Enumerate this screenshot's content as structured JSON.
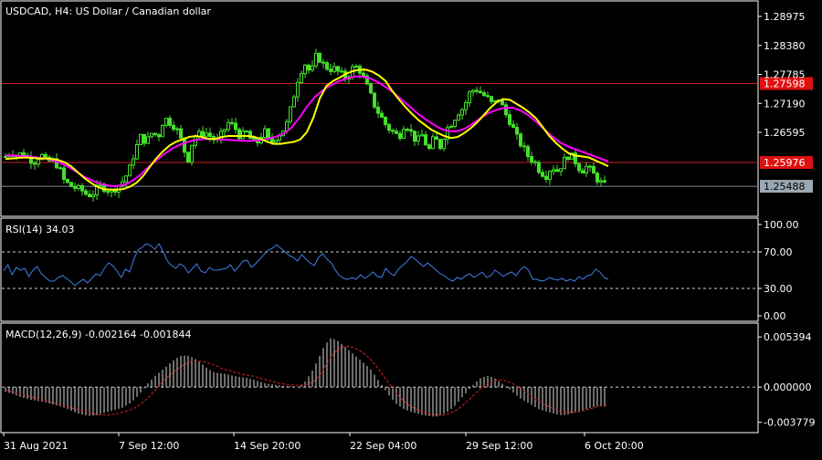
{
  "colors": {
    "background": "#000000",
    "panel_border": "#ffffff",
    "candle": "#44e02b",
    "ma_fast": "#ffff00",
    "ma_slow": "#ff00ff",
    "hline": "#cc2020",
    "rsi_line": "#3f7fe6",
    "macd_hist": "#d9d9d9",
    "macd_signal": "#e02020",
    "label_red": "#e01010",
    "label_gray": "#9aa8b4"
  },
  "chart_data": [
    {
      "type": "candlestick",
      "title": "USDCAD, H4:  US Dollar / Canadian dollar",
      "y_ticks": [
        "1.28975",
        "1.28380",
        "1.27785",
        "1.27190",
        "1.26595"
      ],
      "ylim": [
        1.2489,
        1.29275
      ],
      "hlines": [
        {
          "value": 1.27598,
          "label": "1.27598"
        },
        {
          "value": 1.25976,
          "label": "1.25976"
        }
      ],
      "current_price": {
        "value": 1.25488,
        "label": "1.25488"
      },
      "closes": [
        1.261,
        1.262,
        1.2612,
        1.2618,
        1.2605,
        1.26,
        1.2615,
        1.2598,
        1.2602,
        1.259,
        1.256,
        1.255,
        1.2545,
        1.254,
        1.253,
        1.2535,
        1.255,
        1.2545,
        1.2538,
        1.2548,
        1.256,
        1.258,
        1.262,
        1.265,
        1.264,
        1.266,
        1.265,
        1.269,
        1.268,
        1.267,
        1.264,
        1.26,
        1.265,
        1.2655,
        1.266,
        1.265,
        1.264,
        1.266,
        1.268,
        1.267,
        1.265,
        1.266,
        1.264,
        1.264,
        1.2665,
        1.2635,
        1.265,
        1.266,
        1.268,
        1.273,
        1.278,
        1.28,
        1.278,
        1.282,
        1.28,
        1.279,
        1.279,
        1.278,
        1.277,
        1.279,
        1.2795,
        1.277,
        1.274,
        1.271,
        1.269,
        1.267,
        1.266,
        1.265,
        1.268,
        1.266,
        1.264,
        1.2655,
        1.262,
        1.265,
        1.263,
        1.2665,
        1.268,
        1.27,
        1.271,
        1.274,
        1.275,
        1.274,
        1.273,
        1.2715,
        1.273,
        1.27,
        1.268,
        1.265,
        1.263,
        1.261,
        1.26,
        1.258,
        1.257,
        1.259,
        1.258,
        1.26,
        1.2615,
        1.26,
        1.258,
        1.259,
        1.2575,
        1.256,
        1.255
      ],
      "ma_fast": [
        1.2605,
        1.2606,
        1.2607,
        1.2608,
        1.2607,
        1.2606,
        1.2606,
        1.2605,
        1.2603,
        1.2598,
        1.259,
        1.2578,
        1.2566,
        1.2556,
        1.2548,
        1.2543,
        1.2542,
        1.2542,
        1.2543,
        1.2548,
        1.2556,
        1.257,
        1.2588,
        1.2606,
        1.262,
        1.2632,
        1.264,
        1.2645,
        1.265,
        1.2652,
        1.265,
        1.2646,
        1.2646,
        1.265,
        1.2652,
        1.2652,
        1.2652,
        1.2652,
        1.265,
        1.2646,
        1.264,
        1.2636,
        1.2636,
        1.2638,
        1.264,
        1.2645,
        1.266,
        1.269,
        1.273,
        1.2755,
        1.2765,
        1.2772,
        1.278,
        1.2785,
        1.2788,
        1.2788,
        1.2784,
        1.2776,
        1.2765,
        1.2745,
        1.2728,
        1.2712,
        1.2698,
        1.2685,
        1.2675,
        1.2665,
        1.2658,
        1.2652,
        1.2648,
        1.265,
        1.2658,
        1.2668,
        1.268,
        1.2695,
        1.271,
        1.2722,
        1.2728,
        1.2726,
        1.2718,
        1.271,
        1.27,
        1.2688,
        1.267,
        1.2652,
        1.2638,
        1.2626,
        1.2616,
        1.2612,
        1.261,
        1.2608,
        1.2602,
        1.2596,
        1.259
      ],
      "ma_slow": [
        1.2612,
        1.2612,
        1.2611,
        1.261,
        1.2608,
        1.2606,
        1.2602,
        1.2596,
        1.2588,
        1.2578,
        1.2568,
        1.256,
        1.2554,
        1.255,
        1.2549,
        1.2552,
        1.256,
        1.2572,
        1.2588,
        1.2602,
        1.2615,
        1.2626,
        1.2634,
        1.264,
        1.2644,
        1.2646,
        1.2646,
        1.2645,
        1.2644,
        1.2643,
        1.2642,
        1.2642,
        1.2643,
        1.2646,
        1.265,
        1.2656,
        1.2668,
        1.2688,
        1.2712,
        1.2732,
        1.2746,
        1.2756,
        1.2764,
        1.277,
        1.2774,
        1.2774,
        1.277,
        1.2762,
        1.2752,
        1.274,
        1.2726,
        1.2712,
        1.2698,
        1.2686,
        1.2675,
        1.2666,
        1.2662,
        1.2662,
        1.2668,
        1.2678,
        1.269,
        1.27,
        1.2706,
        1.271,
        1.271,
        1.2704,
        1.2694,
        1.268,
        1.2665,
        1.265,
        1.2638,
        1.263,
        1.2624,
        1.2618,
        1.2612,
        1.2606,
        1.26
      ]
    },
    {
      "type": "line",
      "label": "RSI(14) 34.03",
      "y_ticks": [
        "100.00",
        "70.00",
        "30.00",
        "0.00"
      ],
      "ylim": [
        0,
        100
      ],
      "levels": [
        70,
        30
      ],
      "values": [
        49,
        56,
        45,
        53,
        50,
        52,
        43,
        50,
        54,
        46,
        42,
        38,
        38,
        42,
        44,
        41,
        37,
        33,
        37,
        40,
        36,
        41,
        46,
        44,
        52,
        58,
        55,
        49,
        42,
        51,
        48,
        62,
        72,
        75,
        79,
        77,
        73,
        79,
        70,
        60,
        55,
        52,
        57,
        54,
        47,
        52,
        57,
        49,
        47,
        53,
        50,
        50,
        51,
        52,
        56,
        49,
        54,
        60,
        61,
        53,
        57,
        62,
        67,
        72,
        74,
        78,
        74,
        70,
        66,
        64,
        60,
        67,
        62,
        58,
        55,
        64,
        68,
        62,
        58,
        50,
        44,
        41,
        40,
        42,
        40,
        45,
        41,
        44,
        48,
        43,
        42,
        52,
        47,
        44,
        51,
        55,
        59,
        65,
        62,
        58,
        54,
        58,
        54,
        50,
        46,
        44,
        40,
        38,
        42,
        40,
        44,
        46,
        42,
        45,
        48,
        42,
        44,
        50,
        47,
        43,
        46,
        48,
        44,
        50,
        54,
        50,
        40,
        40,
        38,
        39,
        42,
        40,
        39,
        41,
        38,
        40,
        38,
        43,
        40,
        44,
        45,
        51,
        48,
        42,
        40
      ],
      "values_tail": [
        37,
        33,
        37,
        40,
        36,
        41,
        46,
        44,
        52,
        58,
        55,
        49,
        42,
        40,
        38,
        43,
        40,
        34
      ]
    },
    {
      "type": "bar+line",
      "label": "MACD(12,26,9) -0.002164 -0.001844",
      "y_ticks": [
        "0.005394",
        "0.000000",
        "-0.003779"
      ],
      "ylim": [
        -0.0043,
        0.0059
      ],
      "histogram": [
        -0.0005,
        -0.0007,
        -0.001,
        -0.0012,
        -0.0014,
        -0.0015,
        -0.0016,
        -0.0018,
        -0.002,
        -0.0022,
        -0.0025,
        -0.0028,
        -0.003,
        -0.0031,
        -0.003,
        -0.0028,
        -0.0026,
        -0.0024,
        -0.0022,
        -0.0018,
        -0.0012,
        -0.0004,
        0.0005,
        0.0012,
        0.0018,
        0.0024,
        0.003,
        0.0034,
        0.0034,
        0.0031,
        0.0026,
        0.002,
        0.0016,
        0.0015,
        0.0014,
        0.0012,
        0.0011,
        0.001,
        0.0008,
        0.0006,
        0.0004,
        0.0003,
        0.0002,
        0.0001,
        0.0001,
        0.0,
        0.0006,
        0.0016,
        0.003,
        0.0045,
        0.0053,
        0.005,
        0.0044,
        0.0038,
        0.0032,
        0.0026,
        0.002,
        0.001,
        0.0,
        -0.001,
        -0.0018,
        -0.0023,
        -0.0026,
        -0.0028,
        -0.003,
        -0.0031,
        -0.0032,
        -0.003,
        -0.0026,
        -0.002,
        -0.0012,
        -0.0004,
        0.0004,
        0.001,
        0.0012,
        0.001,
        0.0005,
        0.0,
        -0.0006,
        -0.0012,
        -0.0016,
        -0.002,
        -0.0024,
        -0.0026,
        -0.0028,
        -0.003,
        -0.003,
        -0.0028,
        -0.0026,
        -0.0024,
        -0.0022,
        -0.002,
        -0.0021
      ],
      "signal": [
        -0.0003,
        -0.0005,
        -0.0007,
        -0.0009,
        -0.0011,
        -0.0013,
        -0.0015,
        -0.0017,
        -0.0019,
        -0.0021,
        -0.0023,
        -0.0025,
        -0.0027,
        -0.0029,
        -0.003,
        -0.003,
        -0.0029,
        -0.0027,
        -0.0025,
        -0.0022,
        -0.0017,
        -0.001,
        -0.0002,
        0.0006,
        0.0013,
        0.0019,
        0.0024,
        0.0027,
        0.0028,
        0.0027,
        0.0025,
        0.0022,
        0.0019,
        0.0017,
        0.0015,
        0.0013,
        0.0012,
        0.001,
        0.0008,
        0.0006,
        0.0004,
        0.0003,
        0.0002,
        0.0002,
        0.0003,
        0.0006,
        0.0014,
        0.0026,
        0.0037,
        0.0043,
        0.0044,
        0.0042,
        0.0038,
        0.0032,
        0.0024,
        0.0014,
        0.0004,
        -0.0006,
        -0.0014,
        -0.002,
        -0.0024,
        -0.0027,
        -0.0029,
        -0.003,
        -0.003,
        -0.0028,
        -0.0024,
        -0.0018,
        -0.0011,
        -0.0004,
        0.0002,
        0.0006,
        0.0008,
        0.0007,
        0.0004,
        -0.0001,
        -0.0006,
        -0.0011,
        -0.0016,
        -0.002,
        -0.0023,
        -0.0026,
        -0.0027,
        -0.0027,
        -0.0026,
        -0.0024,
        -0.0022,
        -0.002,
        -0.0018
      ]
    }
  ],
  "x_axis": {
    "labels": [
      "31 Aug 2021",
      "7 Sep 12:00",
      "14 Sep 20:00",
      "22 Sep 04:00",
      "29 Sep 12:00",
      "6 Oct 20:00"
    ]
  }
}
